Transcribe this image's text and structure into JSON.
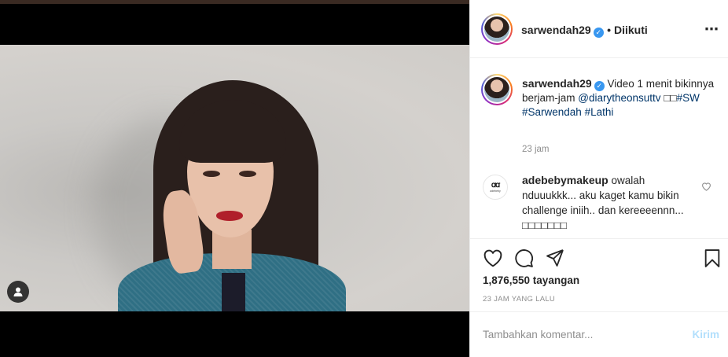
{
  "post": {
    "username": "sarwendah29",
    "follow_status": "• Diikuti",
    "more_icon": "⋯",
    "caption_user": "sarwendah29",
    "caption_text": "Video 1 menit bikinnya berjam-jam",
    "caption_mention": "@diarytheonsuttv",
    "caption_emoji": "□□",
    "caption_tag1": "#SW",
    "caption_tag2": "#Sarwendah",
    "caption_tag3": "#Lathi",
    "caption_time": "23 jam",
    "comment_user": "adebebymakeup",
    "comment_text": "owalah nduuukkk... aku kaget kamu bikin challenge iniih.. dan kereeeennn... □□□□□□□",
    "comment_avatar_logo": "ꭤꭤ",
    "comment_avatar_sub": "adebeby",
    "views": "1,876,550 tayangan",
    "posted_ago": "23 JAM YANG LALU",
    "comment_placeholder": "Tambahkan komentar...",
    "post_button": "Kirim"
  },
  "icons": {
    "verified": "✓",
    "heart": "heart-icon",
    "comment": "comment-icon",
    "share": "share-icon",
    "save": "bookmark-icon",
    "profile": "person-icon"
  },
  "colors": {
    "link": "#003569",
    "verified": "#3897f0",
    "muted": "#8e8e8e",
    "post_disabled": "#b2dffc"
  }
}
